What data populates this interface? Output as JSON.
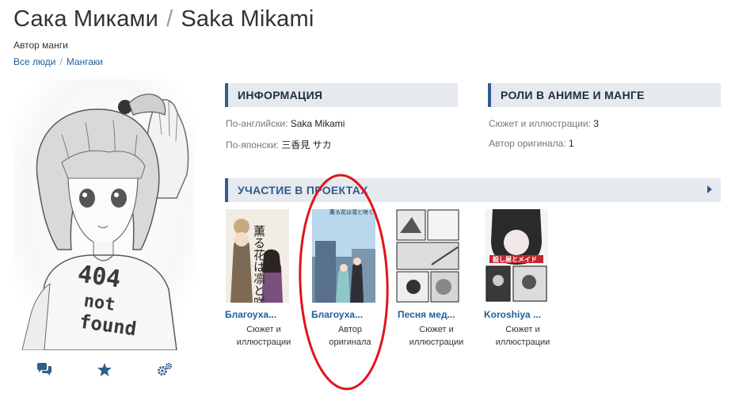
{
  "header": {
    "title_ru": "Сака Миками",
    "separator": "/",
    "title_en": "Saka Mikami",
    "subtitle": "Автор манги"
  },
  "breadcrumbs": [
    {
      "label": "Все люди"
    },
    {
      "label": "Мангаки"
    }
  ],
  "poster": {
    "shirt_line1": "404",
    "shirt_line2": "not",
    "shirt_line3": "found"
  },
  "actions": [
    {
      "icon": "comments-icon"
    },
    {
      "icon": "star-icon"
    },
    {
      "icon": "gears-icon"
    }
  ],
  "info": {
    "heading": "ИНФОРМАЦИЯ",
    "english_label": "По-английски:",
    "english_value": "Saka Mikami",
    "japanese_label": "По-японски:",
    "japanese_value": "三香見 サカ"
  },
  "roles": {
    "heading": "РОЛИ В АНИМЕ И МАНГЕ",
    "story_art_label": "Сюжет и иллюстрации:",
    "story_art_count": "3",
    "original_author_label": "Автор оригинала:",
    "original_author_count": "1"
  },
  "projects": {
    "heading": "УЧАСТИЕ В ПРОЕКТАХ",
    "items": [
      {
        "title": "Благоуха...",
        "role_line1": "Сюжет и",
        "role_line2": "иллюстрации",
        "cover_text": "薫る花は凛と咲く"
      },
      {
        "title": "Благоуха...",
        "role_line1": "Автор",
        "role_line2": "оригинала",
        "cover_text": "薫る花は凛と咲く"
      },
      {
        "title": "Песня мед...",
        "role_line1": "Сюжет и",
        "role_line2": "иллюстрации",
        "cover_text": ""
      },
      {
        "title": "Koroshiya ...",
        "role_line1": "Сюжет и",
        "role_line2": "иллюстрации",
        "cover_text": "殺し屋とメイド"
      }
    ]
  },
  "colors": {
    "link": "#1f5f9a",
    "accent": "#2e5d8f",
    "section_bg": "#e6e9ee",
    "annotation": "#e0141e"
  }
}
